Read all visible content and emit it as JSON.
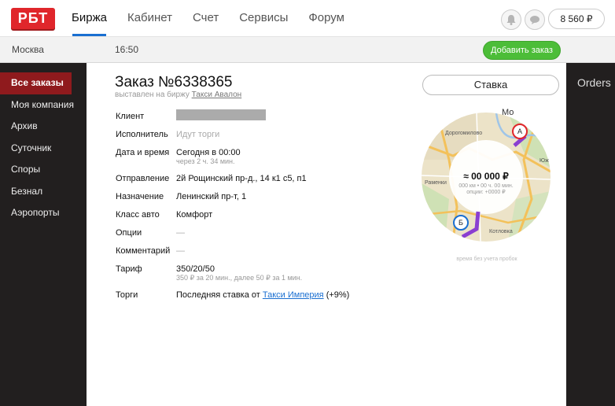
{
  "header": {
    "logo": "РБТ",
    "nav": [
      "Биржа",
      "Кабинет",
      "Счет",
      "Сервисы",
      "Форум"
    ],
    "balance": "8 560 ₽"
  },
  "subbar": {
    "city": "Москва",
    "time": "16:50",
    "add_order": "Добавить заказ"
  },
  "sidebar": {
    "items": [
      "Все заказы",
      "Моя компания",
      "Архив",
      "Суточник",
      "Споры",
      "Безнал",
      "Аэропорты"
    ]
  },
  "right_panel": {
    "label": "Orders"
  },
  "order": {
    "title": "Заказ №6338365",
    "subtitle_prefix": "выставлен на биржу",
    "subtitle_link": "Такси Авалон",
    "bid_button": "Ставка",
    "fields": {
      "client_label": "Клиент",
      "executor_label": "Исполнитель",
      "executor_value": "Идут торги",
      "datetime_label": "Дата и время",
      "datetime_value": "Сегодня в 00:00",
      "datetime_hint": "через 2 ч. 34 мин.",
      "departure_label": "Отправление",
      "departure_value": "2й Рощинский пр-д., 14 к1 с5, п1",
      "destination_label": "Назначение",
      "destination_value": "Ленинский пр-т, 1",
      "class_label": "Класс авто",
      "class_value": "Комфорт",
      "options_label": "Опции",
      "options_value": "—",
      "comments_label": "Комментарий",
      "comments_value": "—",
      "tariff_label": "Тариф",
      "tariff_value": "350/20/50",
      "tariff_hint": "350 ₽ за 20 мин., далее 50 ₽ за 1 мин.",
      "auction_label": "Торги",
      "auction_prefix": "Последняя ставка от",
      "auction_link": "Такси Империя",
      "auction_suffix": "(+9%)"
    }
  },
  "map": {
    "price": "≈ 00 000 ₽",
    "distance": "000 км • 00 ч. 00 мин.",
    "options": "опции: +0000 ₽",
    "marker_a": "А",
    "marker_b": "Б",
    "labels": [
      "Дорогомилово",
      "Раменки",
      "Котловка",
      "Юж",
      "Мо"
    ],
    "note": "время без учета пробок"
  },
  "colors": {
    "brand_red": "#e0262b",
    "active_sidebar": "#8f1a1d",
    "add_green": "#4cbd38",
    "nav_underline": "#1a6fd1",
    "route": "#8a3fd1"
  }
}
